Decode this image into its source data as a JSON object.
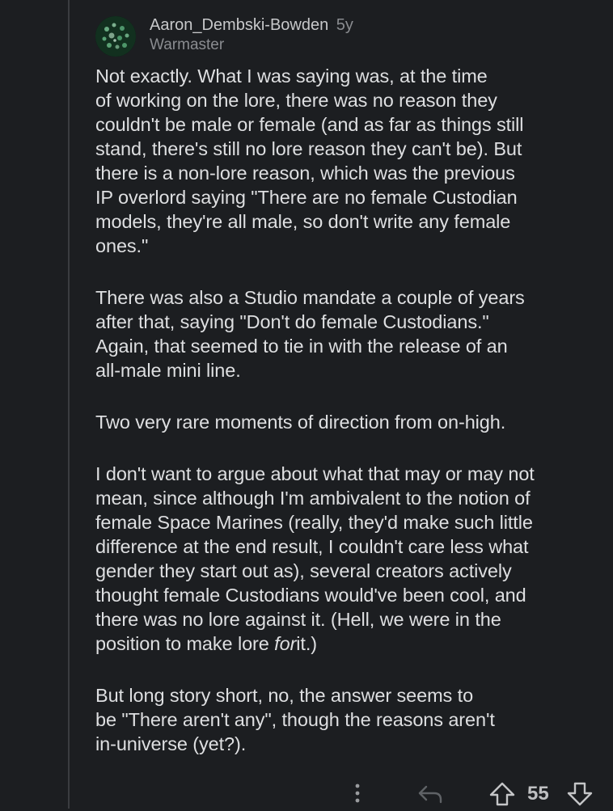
{
  "comment": {
    "author": "Aaron_Dembski-Bowden",
    "age": "5y",
    "flair": "Warmaster",
    "paragraphs": [
      "Not exactly. What I was saying was, at the time\nof working on the lore, there was no reason they\ncouldn't be male or female (and as far as things still\nstand, there's still no lore reason they can't be). But\nthere is a non-lore reason, which was the previous\nIP overlord saying \"There are no female Custodian\nmodels, they're all male, so don't write any female\nones.\"",
      "There was also a Studio mandate a couple of years\nafter that, saying \"Don't do female Custodians.\"\nAgain, that seemed to tie in with the release of an\nall-male mini line.",
      "Two very rare moments of direction from on-high.",
      "But long story short, no, the answer seems to\nbe \"There aren't any\", though the reasons aren't\nin-universe (yet?)."
    ],
    "p4_before": "I don't want to argue about what that may or may not\nmean, since although I'm ambivalent to the notion of\nfemale Space Marines (really, they'd make such little\ndifference at the end result, I couldn't care less what\ngender they start out as), several creators actively\nthought female Custodians would've been cool, and\nthere was no lore against it. (Hell, we were in the\nposition to make lore ",
    "p4_emphasis": "for",
    "p4_after": "it.)",
    "score": "55"
  },
  "icons": {
    "avatar": "avatar-image",
    "more": "more-vertical-icon",
    "reply": "reply-arrow-icon",
    "upvote": "upvote-arrow-icon",
    "downvote": "downvote-arrow-icon"
  }
}
